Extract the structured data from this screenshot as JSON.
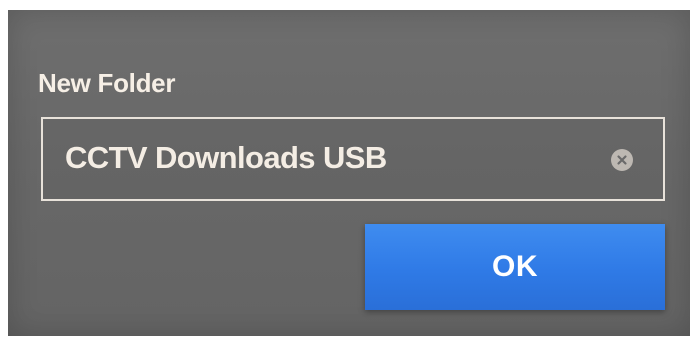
{
  "dialog": {
    "title": "New Folder",
    "folder_name_field": {
      "value": "CCTV Downloads USB",
      "clear_icon": "clear-circle-x-icon"
    },
    "ok_button_label": "OK"
  },
  "colors": {
    "dialog_background": "#686868",
    "text": "#f4ede4",
    "field_border": "#e8e2da",
    "ok_button": "#2f7ae6"
  }
}
